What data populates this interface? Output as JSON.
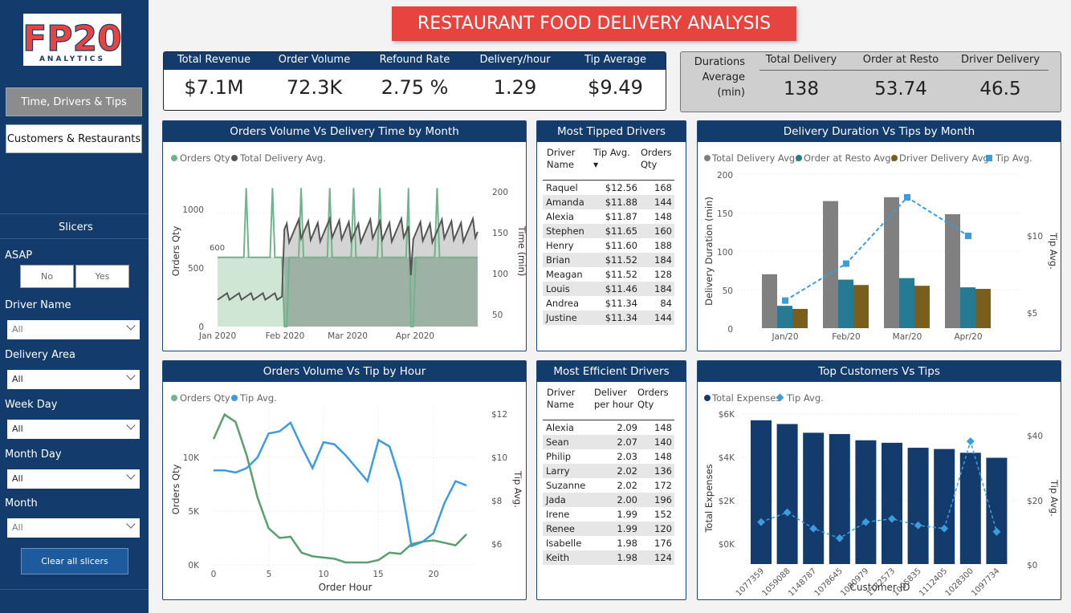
{
  "colors": {
    "navy": "#133b6b",
    "title_red": "#e8443f",
    "green": "#6fb58a",
    "gray_line": "#555555",
    "bar_gray": "#808080",
    "teal": "#267a92",
    "olive": "#7a5f1c",
    "blue": "#3d9be0"
  },
  "logo": {
    "text": "FP20",
    "sub": "ANALYTICS"
  },
  "nav": {
    "page1": "Time, Drivers & Tips",
    "page2": "Customers & Restaurants"
  },
  "slicers": {
    "title": "Slicers",
    "asap_label": "ASAP",
    "asap_no": "No",
    "asap_yes": "Yes",
    "driver_label": "Driver Name",
    "driver_val": "All",
    "area_label": "Delivery Area",
    "area_val": "All",
    "weekday_label": "Week Day",
    "weekday_val": "All",
    "monthday_label": "Month Day",
    "monthday_val": "All",
    "month_label": "Month",
    "month_val": "All",
    "clear": "Clear all slicers"
  },
  "title": "RESTAURANT FOOD DELIVERY ANALYSIS",
  "kpis": [
    {
      "label": "Total Revenue",
      "value": "$7.1M"
    },
    {
      "label": "Order Volume",
      "value": "72.3K"
    },
    {
      "label": "Refound Rate",
      "value": "2.75 %"
    },
    {
      "label": "Delivery/hour",
      "value": "1.29"
    },
    {
      "label": "Tip Average",
      "value": "$9.49"
    }
  ],
  "durations": {
    "label1": "Durations",
    "label2": "Average",
    "label3": "(min)",
    "total_label": "Total Delivery",
    "total": "138",
    "resto_label": "Order at Resto",
    "resto": "53.74",
    "driver_label": "Driver Delivery",
    "driver": "46.5"
  },
  "chart1": {
    "title": "Orders Volume Vs Delivery Time by Month",
    "legend": [
      "Orders Qty",
      "Total Delivery Avg."
    ],
    "ylabel": "Orders Qty",
    "y2label": "Time (min)",
    "yticks": [
      "1000",
      "500",
      "0"
    ],
    "y2ticks": [
      "200",
      "150",
      "100",
      "50"
    ],
    "xticks": [
      "Jan 2020",
      "Feb 2020",
      "Mar 2020",
      "Apr 2020"
    ],
    "refline": "600"
  },
  "tipped": {
    "title": "Most Tipped Drivers",
    "h1": "Driver",
    "h1b": "Name",
    "h2": "Tip Avg.",
    "h3": "Orders",
    "h3b": "Qty",
    "rows": [
      [
        "Raquel",
        "$12.56",
        "168"
      ],
      [
        "Amanda",
        "$11.88",
        "144"
      ],
      [
        "Alexia",
        "$11.87",
        "148"
      ],
      [
        "Stephen",
        "$11.65",
        "160"
      ],
      [
        "Henry",
        "$11.60",
        "188"
      ],
      [
        "Brian",
        "$11.52",
        "184"
      ],
      [
        "Meagan",
        "$11.52",
        "128"
      ],
      [
        "Louis",
        "$11.46",
        "184"
      ],
      [
        "Andrea",
        "$11.34",
        "84"
      ],
      [
        "Justine",
        "$11.34",
        "144"
      ]
    ]
  },
  "chart2": {
    "title": "Delivery Duration Vs Tips by Month",
    "legend": [
      "Total Delivery Avg.",
      "Order at Resto Avg.",
      "Driver Delivery Avg.",
      "Tip Avg."
    ],
    "ylabel": "Delivery Duration (min)",
    "y2label": "Tip Avg.",
    "yticks": [
      "200",
      "150",
      "100",
      "50",
      "0"
    ],
    "y2ticks": [
      "$10",
      "$5"
    ]
  },
  "chart3": {
    "title": "Orders Volume Vs Tip by Hour",
    "legend": [
      "Orders Qty",
      "Tip Avg."
    ],
    "ylabel": "Orders Qty",
    "y2label": "Tip Avg.",
    "xlabel": "Order Hour",
    "yticks": [
      "10K",
      "5K",
      "0K"
    ],
    "y2ticks": [
      "$12",
      "$10",
      "$8",
      "$6"
    ],
    "xticks": [
      "0",
      "5",
      "10",
      "15",
      "20"
    ]
  },
  "efficient": {
    "title": "Most Efficient Drivers",
    "h1": "Driver",
    "h1b": "Name",
    "h2": "Deliver",
    "h2b": "per hour",
    "h3": "Orders",
    "h3b": "Qty",
    "rows": [
      [
        "Alexia",
        "2.09",
        "148"
      ],
      [
        "Sean",
        "2.07",
        "140"
      ],
      [
        "Philip",
        "2.03",
        "148"
      ],
      [
        "Larry",
        "2.02",
        "136"
      ],
      [
        "Suzanne",
        "2.02",
        "172"
      ],
      [
        "Jada",
        "2.00",
        "196"
      ],
      [
        "Irene",
        "1.99",
        "152"
      ],
      [
        "Renee",
        "1.99",
        "120"
      ],
      [
        "Isabelle",
        "1.98",
        "176"
      ],
      [
        "Keith",
        "1.98",
        "124"
      ]
    ]
  },
  "chart4": {
    "title": "Top Customers Vs Tips",
    "legend": [
      "Total Expenses",
      "Tip Avg."
    ],
    "ylabel": "Total Expenses",
    "y2label": "Tip Avg.",
    "xlabel": "Customer ID",
    "yticks": [
      "$6K",
      "$4K",
      "$2K",
      "$0K"
    ],
    "y2ticks": [
      "$40",
      "$20",
      "$0"
    ]
  },
  "chart_data": [
    {
      "type": "line",
      "title": "Orders Volume Vs Delivery Time by Month",
      "series": [
        {
          "name": "Orders Qty",
          "note": "daily, ~300 Jan, ~600 Feb-Apr with spikes to ~1200"
        },
        {
          "name": "Total Delivery Avg.",
          "note": "daily minutes ~70 Jan, ~140-160 Feb-Apr"
        }
      ],
      "xlabel": "",
      "ylabel": "Orders Qty",
      "ylim": [
        0,
        1300
      ],
      "y2lim": [
        40,
        220
      ]
    },
    {
      "type": "bar",
      "title": "Delivery Duration Vs Tips by Month",
      "categories": [
        "Jan/20",
        "Feb/20",
        "Mar/20",
        "Apr/20"
      ],
      "series": [
        {
          "name": "Total Delivery Avg.",
          "values": [
            70,
            165,
            170,
            148
          ]
        },
        {
          "name": "Order at Resto Avg.",
          "values": [
            29,
            63,
            65,
            53
          ]
        },
        {
          "name": "Driver Delivery Avg.",
          "values": [
            25,
            56,
            55,
            51
          ]
        },
        {
          "name": "Tip Avg.",
          "values": [
            5.8,
            8.2,
            12.5,
            10.0
          ]
        }
      ],
      "ylabel": "Delivery Duration (min)",
      "ylim": [
        0,
        200
      ],
      "y2label": "Tip Avg."
    },
    {
      "type": "line",
      "title": "Orders Volume Vs Tip by Hour",
      "x": [
        0,
        1,
        2,
        3,
        4,
        5,
        6,
        7,
        8,
        9,
        10,
        11,
        12,
        13,
        14,
        15,
        16,
        17,
        18,
        19,
        20,
        21,
        22,
        23
      ],
      "series": [
        {
          "name": "Orders Qty",
          "values": [
            10300,
            12300,
            11700,
            9000,
            5500,
            3000,
            2200,
            2300,
            1000,
            700,
            600,
            500,
            200,
            200,
            200,
            400,
            1000,
            900,
            1700,
            1900,
            2000,
            1800,
            1600,
            2500
          ]
        },
        {
          "name": "Tip Avg.",
          "values": [
            9.4,
            9.4,
            9.3,
            9.5,
            10.0,
            11.1,
            11.2,
            11.6,
            10.5,
            9.5,
            10.7,
            10.6,
            10.1,
            9.5,
            8.9,
            10.8,
            10.5,
            8.9,
            5.9,
            6.1,
            6.5,
            7.9,
            8.9,
            8.7
          ]
        }
      ],
      "xlabel": "Order Hour",
      "ylabel": "Orders Qty",
      "ylim": [
        0,
        13000
      ],
      "y2lim": [
        5,
        12
      ]
    },
    {
      "type": "bar",
      "title": "Top Customers Vs Tips",
      "categories": [
        "1077359",
        "1059088",
        "1148787",
        "1078645",
        "1080979",
        "1172573",
        "1005835",
        "1112405",
        "1028300",
        "1097734"
      ],
      "series": [
        {
          "name": "Total Expenses",
          "values": [
            5750,
            5600,
            5250,
            5200,
            4950,
            4850,
            4650,
            4600,
            4450,
            4250
          ]
        },
        {
          "name": "Tip Avg.",
          "values": [
            13,
            16,
            11,
            8,
            13,
            14,
            12,
            11,
            38,
            10
          ]
        }
      ],
      "xlabel": "Customer ID",
      "ylabel": "Total Expenses",
      "ylim": [
        0,
        6000
      ],
      "y2lim": [
        0,
        40
      ]
    }
  ]
}
